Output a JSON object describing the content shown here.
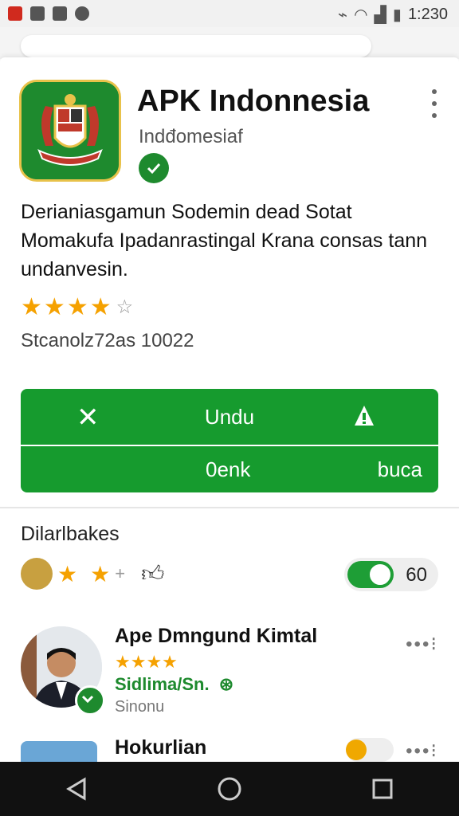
{
  "status_bar": {
    "time": "1:230"
  },
  "app": {
    "title": "APK Indonnesia",
    "developer": "Indđomesiaf",
    "description": "Derianiasgamun Sodemin dead Sotat Momakufa Ipadanrastingal Krana consas tann undanvesin.",
    "rating_stars": 4,
    "stats": "Stcanolz72as 10022"
  },
  "buttons": {
    "primary_label": "Undu",
    "open_label": "0enk",
    "secondary_label": "buca"
  },
  "reviews_section": {
    "title": "Dilarlbakes",
    "count": "60"
  },
  "reviews": [
    {
      "name": "Ape Dmngund Kimtal",
      "stars": "★★★★",
      "subtitle": "Sidlima/Sn.",
      "subtext": "Sinonu"
    },
    {
      "name": "Hokurlian"
    }
  ],
  "colors": {
    "accent": "#169b2e",
    "star": "#f5a100"
  }
}
